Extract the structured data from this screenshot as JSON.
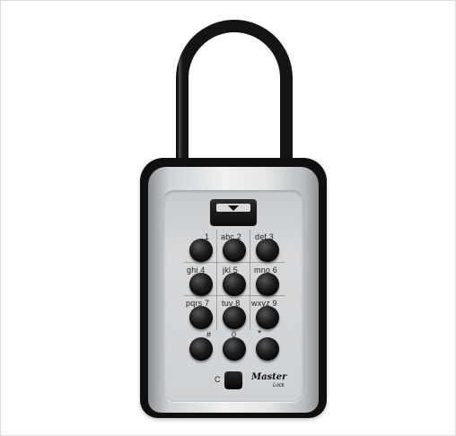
{
  "product": {
    "brand_main": "Master",
    "brand_sub": "Lock",
    "clear_label": "C",
    "keys": [
      {
        "id": "1",
        "label": "1"
      },
      {
        "id": "2",
        "label": "abc 2"
      },
      {
        "id": "3",
        "label": "def 3"
      },
      {
        "id": "4",
        "label": "ghi 4"
      },
      {
        "id": "5",
        "label": "jkl 5"
      },
      {
        "id": "6",
        "label": "mno 6"
      },
      {
        "id": "7",
        "label": "pqrs 7"
      },
      {
        "id": "8",
        "label": "tuv 8"
      },
      {
        "id": "9",
        "label": "wxyz 9"
      },
      {
        "id": "hash",
        "label": "#"
      },
      {
        "id": "0",
        "label": "0"
      },
      {
        "id": "star",
        "label": "*"
      }
    ]
  },
  "colors": {
    "shackle": "#141414",
    "body_outer": "#0f0f0f",
    "faceplate": "#d6d8da",
    "key": "#0a0a0a"
  }
}
